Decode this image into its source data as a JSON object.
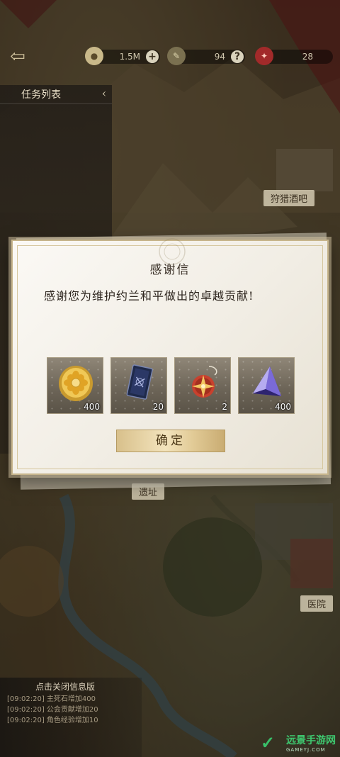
{
  "topbar": {
    "back_icon": "back-arrow-icon",
    "resources": [
      {
        "icon": "coin-icon",
        "value": "1.5M"
      },
      {
        "icon": "feather-icon",
        "value": "94"
      },
      {
        "icon": "stamina-icon",
        "value": "28"
      }
    ]
  },
  "task_panel": {
    "title": "任务列表"
  },
  "map_labels": {
    "tavern": "狩猎酒吧",
    "ruins": "遗址",
    "hospital": "医院"
  },
  "dialog": {
    "title": "感谢信",
    "message": "感谢您为维护约兰和平做出的卓越贡献!",
    "rewards": [
      {
        "icon": "gold-coin-icon",
        "count": "400"
      },
      {
        "icon": "exp-card-icon",
        "count": "20"
      },
      {
        "icon": "compass-amulet-icon",
        "count": "2"
      },
      {
        "icon": "purple-crystal-icon",
        "count": "400"
      }
    ],
    "confirm_label": "确定"
  },
  "log": {
    "header": "点击关闭信息版",
    "lines": [
      "[09:02:20] 主死石增加400",
      "[09:02:20] 公会贡献增加20",
      "[09:02:20] 角色经验增加10"
    ]
  },
  "watermark": {
    "cn": "远景手游网",
    "en": "GAMEYJ.COM"
  },
  "colors": {
    "accent_gold": "#d8c08b",
    "dialog_bg": "#f4f0e8",
    "watermark_green": "#3ec970"
  }
}
